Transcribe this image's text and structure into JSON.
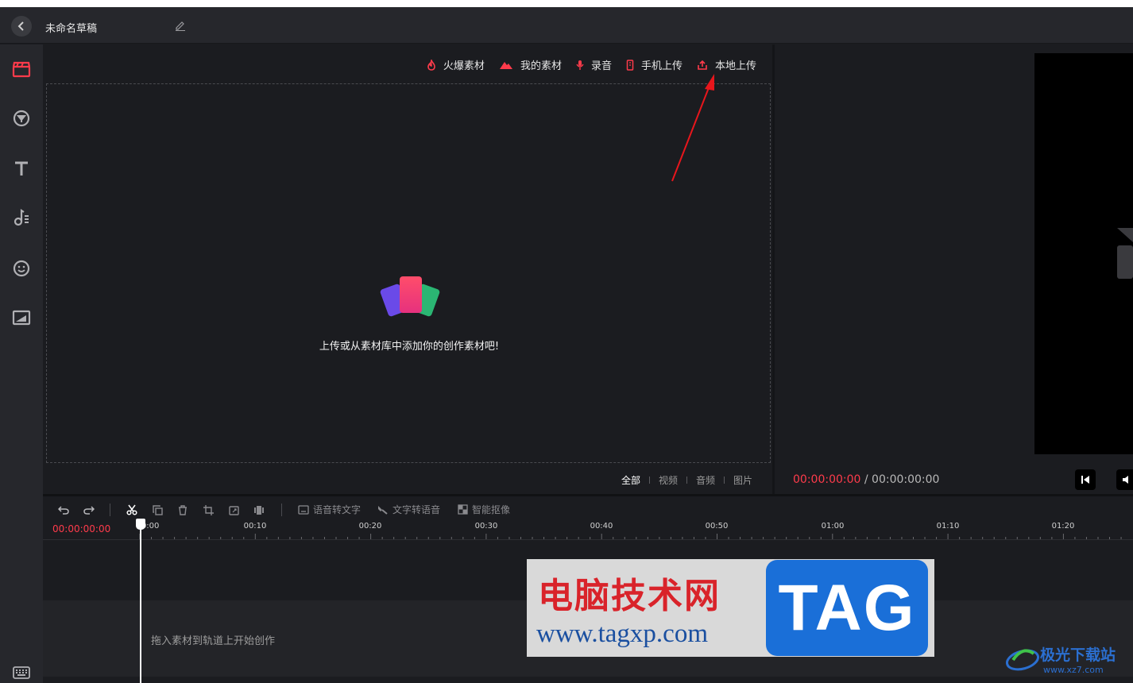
{
  "titlebar": {
    "draft_name": "未命名草稿"
  },
  "sidebar": {
    "items": [
      {
        "icon": "clapperboard-icon",
        "active": true
      },
      {
        "icon": "filter-icon",
        "active": false
      },
      {
        "icon": "text-icon",
        "active": false
      },
      {
        "icon": "music-icon",
        "active": false
      },
      {
        "icon": "sticker-icon",
        "active": false
      },
      {
        "icon": "image-icon",
        "active": false
      },
      {
        "icon": "keyboard-icon",
        "active": false
      }
    ]
  },
  "media": {
    "tabs": [
      {
        "label": "火爆素材",
        "icon": "fire-icon"
      },
      {
        "label": "我的素材",
        "icon": "mountain-icon"
      },
      {
        "label": "录音",
        "icon": "microphone-icon"
      },
      {
        "label": "手机上传",
        "icon": "phone-icon"
      },
      {
        "label": "本地上传",
        "icon": "upload-icon"
      }
    ],
    "empty_hint": "上传或从素材库中添加你的创作素材吧!",
    "filters": [
      {
        "label": "全部",
        "active": true
      },
      {
        "label": "视频",
        "active": false
      },
      {
        "label": "音频",
        "active": false
      },
      {
        "label": "图片",
        "active": false
      }
    ]
  },
  "preview": {
    "current_time": "00:00:00:00",
    "separator": " / ",
    "total_time": "00:00:00:00"
  },
  "timeline": {
    "tools": {
      "speech_to_text": "语音转文字",
      "text_to_speech": "文字转语音",
      "smart_matting": "智能抠像"
    },
    "current_time": "00:00:00:00",
    "ruler_labels": [
      "00:00",
      "00:10",
      "00:20",
      "00:30",
      "00:40",
      "00:50",
      "01:00",
      "01:10",
      "01:20"
    ],
    "empty_track_hint": "拖入素材到轨道上开始创作"
  },
  "watermark": {
    "chinese": "电脑技术网",
    "url": "www.tagxp.com",
    "tag": "TAG"
  },
  "corner_logo": {
    "name": "极光下载站",
    "url": "www.xz7.com"
  },
  "colors": {
    "accent": "#ff3b4b",
    "panel_bg": "#1b1c20",
    "sidebar_bg": "#26272c"
  }
}
